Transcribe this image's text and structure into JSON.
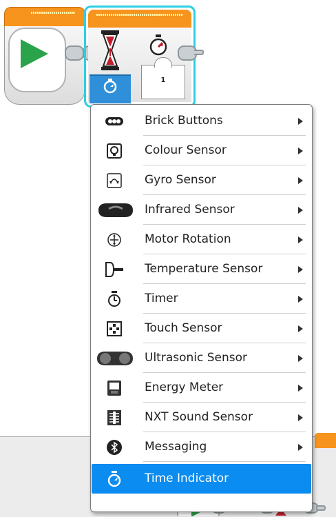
{
  "program": {
    "wait_block": {
      "port_value": "1"
    }
  },
  "menu": {
    "items": [
      {
        "label": "Brick Buttons",
        "icon": "brick-buttons-icon",
        "submenu": true
      },
      {
        "label": "Colour Sensor",
        "icon": "colour-sensor-icon",
        "submenu": true
      },
      {
        "label": "Gyro Sensor",
        "icon": "gyro-sensor-icon",
        "submenu": true
      },
      {
        "label": "Infrared Sensor",
        "icon": "infrared-sensor-icon",
        "submenu": true
      },
      {
        "label": "Motor Rotation",
        "icon": "motor-rotation-icon",
        "submenu": true
      },
      {
        "label": "Temperature Sensor",
        "icon": "temperature-sensor-icon",
        "submenu": true
      },
      {
        "label": "Timer",
        "icon": "timer-icon",
        "submenu": true
      },
      {
        "label": "Touch Sensor",
        "icon": "touch-sensor-icon",
        "submenu": true
      },
      {
        "label": "Ultrasonic Sensor",
        "icon": "ultrasonic-sensor-icon",
        "submenu": true
      },
      {
        "label": "Energy Meter",
        "icon": "energy-meter-icon",
        "submenu": true
      },
      {
        "label": "NXT Sound Sensor",
        "icon": "nxt-sound-sensor-icon",
        "submenu": true
      },
      {
        "label": "Messaging",
        "icon": "messaging-icon",
        "submenu": true
      },
      {
        "label": "Time Indicator",
        "icon": "time-indicator-icon",
        "submenu": false,
        "selected": true
      }
    ]
  },
  "colors": {
    "block_header": "#f7941d",
    "selection_outline": "#2ccfe3",
    "mode_button": "#2f8fd8",
    "menu_highlight": "#0a8cf0",
    "play_green": "#2aa34a"
  }
}
